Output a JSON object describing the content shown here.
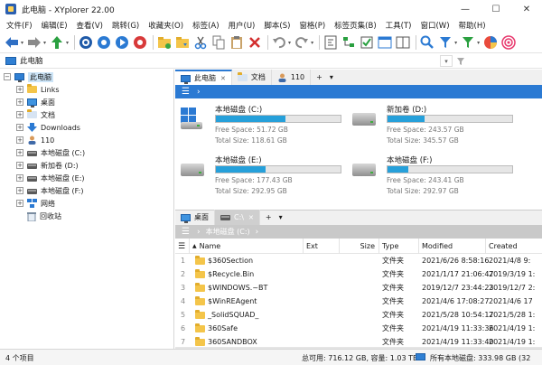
{
  "window": {
    "title": "此电脑 - XYplorer 22.00",
    "controls": {
      "minimize": "—",
      "maximize": "☐",
      "close": "✕"
    }
  },
  "menu": [
    "文件(F)",
    "编辑(E)",
    "查看(V)",
    "跳转(G)",
    "收藏夹(O)",
    "标签(A)",
    "用户(U)",
    "脚本(S)",
    "窗格(P)",
    "标签页集(B)",
    "工具(T)",
    "窗口(W)",
    "帮助(H)"
  ],
  "address": {
    "value": "此电脑"
  },
  "tree": {
    "root": "此电脑",
    "items": [
      "Links",
      "桌面",
      "文档",
      "Downloads",
      "110",
      "本地磁盘 (C:)",
      "新加卷 (D:)",
      "本地磁盘 (E:)",
      "本地磁盘 (F:)",
      "网络",
      "回收站"
    ]
  },
  "pane1": {
    "tabs": [
      "此电脑",
      "文档",
      "110"
    ],
    "add_tab": "+",
    "tab_menu": "▾",
    "breadcrumb": "›",
    "drives": [
      {
        "name": "本地磁盘 (C:)",
        "free": "Free Space: 51.72 GB",
        "total": "Total Size: 118.61 GB",
        "used_fraction": 0.56
      },
      {
        "name": "新加卷 (D:)",
        "free": "Free Space: 243.57 GB",
        "total": "Total Size: 345.57 GB",
        "used_fraction": 0.3
      },
      {
        "name": "本地磁盘 (E:)",
        "free": "Free Space: 177.43 GB",
        "total": "Total Size: 292.95 GB",
        "used_fraction": 0.4
      },
      {
        "name": "本地磁盘 (F:)",
        "free": "Free Space: 243.41 GB",
        "total": "Total Size: 292.97 GB",
        "used_fraction": 0.17
      }
    ]
  },
  "pane2": {
    "tabs": [
      "桌面",
      "C:\\"
    ],
    "add_tab": "+",
    "tab_menu": "▾",
    "breadcrumb": "本地磁盘 (C:)",
    "columns": {
      "name": "Name",
      "ext": "Ext",
      "size": "Size",
      "type": "Type",
      "modified": "Modified",
      "created": "Created"
    },
    "rows": [
      {
        "num": "1",
        "name": "$360Section",
        "type": "文件夹",
        "modified": "2021/6/26 8:58:16",
        "created": "2021/4/8 9:"
      },
      {
        "num": "2",
        "name": "$Recycle.Bin",
        "type": "文件夹",
        "modified": "2021/1/17 21:06:47",
        "created": "2019/3/19 1:"
      },
      {
        "num": "3",
        "name": "$WINDOWS.~BT",
        "type": "文件夹",
        "modified": "2019/12/7 23:44:23",
        "created": "2019/12/7 2:"
      },
      {
        "num": "4",
        "name": "$WinREAgent",
        "type": "文件夹",
        "modified": "2021/4/6 17:08:27",
        "created": "2021/4/6 17"
      },
      {
        "num": "5",
        "name": "_SolidSQUAD_",
        "type": "文件夹",
        "modified": "2021/5/28 10:54:17",
        "created": "2021/5/28 1:"
      },
      {
        "num": "6",
        "name": "360Safe",
        "type": "文件夹",
        "modified": "2021/4/19 11:33:36",
        "created": "2021/4/19 1:"
      },
      {
        "num": "7",
        "name": "360SANDBOX",
        "type": "文件夹",
        "modified": "2021/4/19 11:33:40",
        "created": "2021/4/19 1:"
      }
    ]
  },
  "status": {
    "items": "4 个项目",
    "total": "总可用: 716.12 GB, 容量: 1.03 TB",
    "all_drives": "所有本地磁盘: 333.98 GB (32"
  },
  "colors": {
    "accent": "#2b7ad3",
    "bar_fill": "#26a0da",
    "folder": "#f4c54a"
  }
}
